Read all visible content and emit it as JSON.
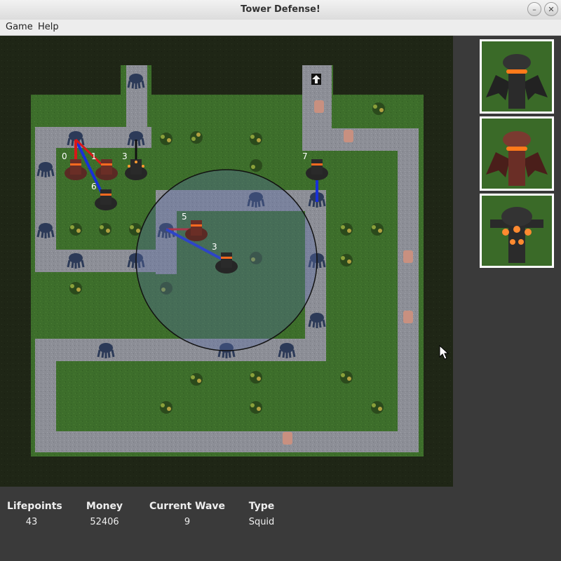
{
  "window": {
    "title": "Tower Defense!",
    "minimize_glyph": "–",
    "close_glyph": "✕"
  },
  "menu": [
    {
      "label": "Game"
    },
    {
      "label": "Help"
    }
  ],
  "towers": [
    {
      "label": "0",
      "type": "red"
    },
    {
      "label": "1",
      "type": "red"
    },
    {
      "label": "3",
      "type": "orb"
    },
    {
      "label": "6",
      "type": "dark"
    },
    {
      "label": "7",
      "type": "dark"
    },
    {
      "label": "5",
      "type": "red"
    },
    {
      "label": "3",
      "type": "dark"
    }
  ],
  "tower_menu": [
    {
      "name": "dark-tower",
      "color": "#2a2a2a",
      "ring": "#ff7a1a"
    },
    {
      "name": "red-tower",
      "color": "#6a2a22",
      "ring": "#ff7a1a"
    },
    {
      "name": "orb-tower",
      "color": "#2c2c2c",
      "ring": "#ff8a30"
    }
  ],
  "status": {
    "lifepoints": {
      "label": "Lifepoints",
      "value": "43"
    },
    "money": {
      "label": "Money",
      "value": "52406"
    },
    "wave": {
      "label": "Current Wave",
      "value": "9"
    },
    "type": {
      "label": "Type",
      "value": "Squid"
    }
  },
  "colors": {
    "grass": "#3c6e2c",
    "path": "#8a8c94",
    "dark": "#1e2416",
    "laser_red": "#d81818",
    "laser_blue": "#1830d8"
  }
}
